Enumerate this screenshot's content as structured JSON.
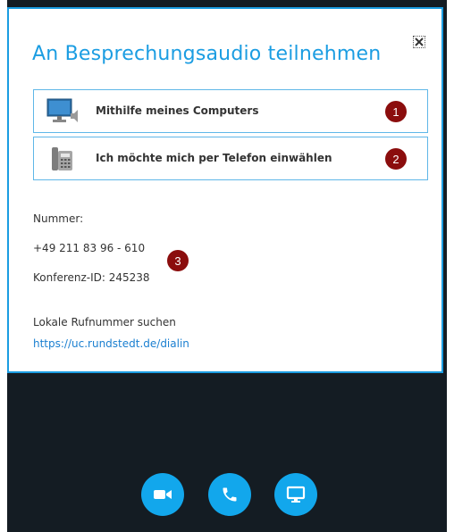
{
  "dialog": {
    "title": "An Besprechungsaudio teilnehmen",
    "close_icon": "close-icon"
  },
  "options": [
    {
      "label": "Mithilfe meines Computers",
      "icon": "computer-speaker-icon",
      "badge": "1"
    },
    {
      "label": "Ich möchte mich per Telefon einwählen",
      "icon": "desk-phone-icon",
      "badge": "2"
    }
  ],
  "dialin": {
    "number_label": "Nummer:",
    "number": "+49 211 83 96 - 610",
    "conference_id": "Konferenz-ID: 245238",
    "badge": "3",
    "local_label": "Lokale Rufnummer suchen",
    "link": "https://uc.rundstedt.de/dialin"
  },
  "toolbar": {
    "buttons": [
      {
        "name": "video-button",
        "icon": "video-camera-icon"
      },
      {
        "name": "call-button",
        "icon": "phone-icon"
      },
      {
        "name": "present-button",
        "icon": "monitor-icon"
      }
    ]
  },
  "colors": {
    "accent": "#1b9de2",
    "badge": "#8b0d0d",
    "background_dark": "#141c23",
    "toolbar_button": "#12a7ec"
  }
}
